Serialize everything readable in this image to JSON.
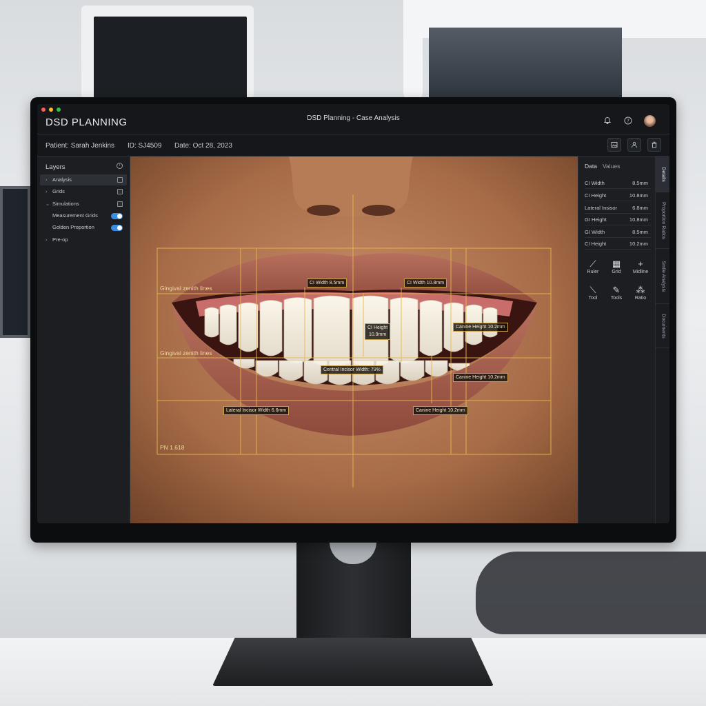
{
  "app": {
    "name": "DSD PLANNING",
    "window_title": "DSD Planning - Case Analysis",
    "window_dots": [
      "#ff5f56",
      "#ffbd2e",
      "#27c93f"
    ]
  },
  "header_icons": [
    "bell-icon",
    "help-icon",
    "user-avatar"
  ],
  "patient": {
    "name": "Patient: Sarah Jenkins",
    "id": "ID: SJ4509",
    "date": "Date: Oct 28, 2023"
  },
  "patient_actions": [
    "image-icon",
    "person-icon",
    "trash-icon"
  ],
  "layers": {
    "title": "Layers",
    "items": [
      {
        "label": "Analysis",
        "selected": true
      },
      {
        "label": "Grids"
      },
      {
        "label": "Simulations",
        "expanded": true
      },
      {
        "label": "Measurement Grids",
        "toggle": true
      },
      {
        "label": "Golden Proportion",
        "toggle": true
      },
      {
        "label": "Pre-op"
      }
    ]
  },
  "overlay": {
    "line_color": "#e9b84a",
    "labels": {
      "gingival_top": "Gingival zenith lines",
      "gingival_bottom": "Gingival zenith lines",
      "ci_width_left": "CI Width 8.5mm",
      "ci_width_right": "CI Width 10.8mm",
      "ci_height": "CI Height",
      "ci_height_value": "10.9mm",
      "central_incisor": "Central Incisor Width: 79%",
      "canine_height_upper": "Canine Height 10.2mm",
      "canine_height_mid": "Canine Height 10.2mm",
      "lateral_width": "Lateral Incisor Width 6.6mm",
      "canine_height_lower": "Canine Height 10.2mm",
      "ratio": "PN 1.618"
    }
  },
  "data_panel": {
    "tabs": [
      "Data",
      "Values"
    ],
    "rows": [
      {
        "label": "CI Width",
        "value": "8.5mm"
      },
      {
        "label": "CI Height",
        "value": "10.8mm"
      },
      {
        "label": "Lateral Insisor",
        "value": "6.8mm"
      },
      {
        "label": "GI Height",
        "value": "10.8mm"
      },
      {
        "label": "GI Width",
        "value": "8.5mm"
      },
      {
        "label": "CI Height",
        "value": "10.2mm"
      }
    ],
    "tools": [
      {
        "label": "Ruler",
        "glyph": "⟋"
      },
      {
        "label": "Grid",
        "glyph": "▦"
      },
      {
        "label": "Midline",
        "glyph": "+"
      },
      {
        "label": "Tool",
        "glyph": "⟍"
      },
      {
        "label": "Tools",
        "glyph": "✎"
      },
      {
        "label": "Ratio",
        "glyph": "⁂"
      }
    ]
  },
  "side_tabs": [
    "Details",
    "Proportion Ratios",
    "Smile Analysis",
    "Documents"
  ]
}
